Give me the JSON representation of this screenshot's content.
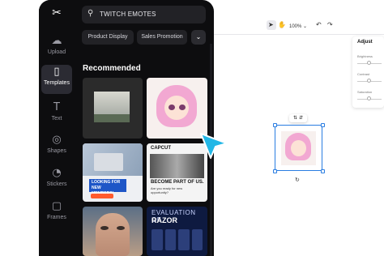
{
  "rail": {
    "items": [
      {
        "label": "Upload",
        "icon": "cloud-upload-icon"
      },
      {
        "label": "Templates",
        "icon": "templates-icon"
      },
      {
        "label": "Text",
        "icon": "text-icon"
      },
      {
        "label": "Shapes",
        "icon": "shapes-icon"
      },
      {
        "label": "Stickers",
        "icon": "stickers-icon"
      },
      {
        "label": "Frames",
        "icon": "frames-icon"
      }
    ]
  },
  "search": {
    "value": "TWITCH EMOTES"
  },
  "chips": [
    "Product Display",
    "Sales Promotion"
  ],
  "section_title": "Recommended",
  "thumbs": {
    "t4_header": "CAPCUT",
    "t4_headline": "BECOME PART OF US.",
    "t4_sub": "Are you ready for new opportunity?",
    "t3_tag": "LOOKING FOR NEW MEMBERS!",
    "t6_line1": "EVALUATION OF",
    "t6_line2": "RAZOR"
  },
  "canvas": {
    "zoom": "100%",
    "adjust_title": "Adjust",
    "adjust_labels": [
      "Brightness",
      "Contrast",
      "Saturation"
    ]
  },
  "colors": {
    "panel": "#0d0d0f",
    "accent": "#2a7de1",
    "cursor": "#22b7e6"
  }
}
